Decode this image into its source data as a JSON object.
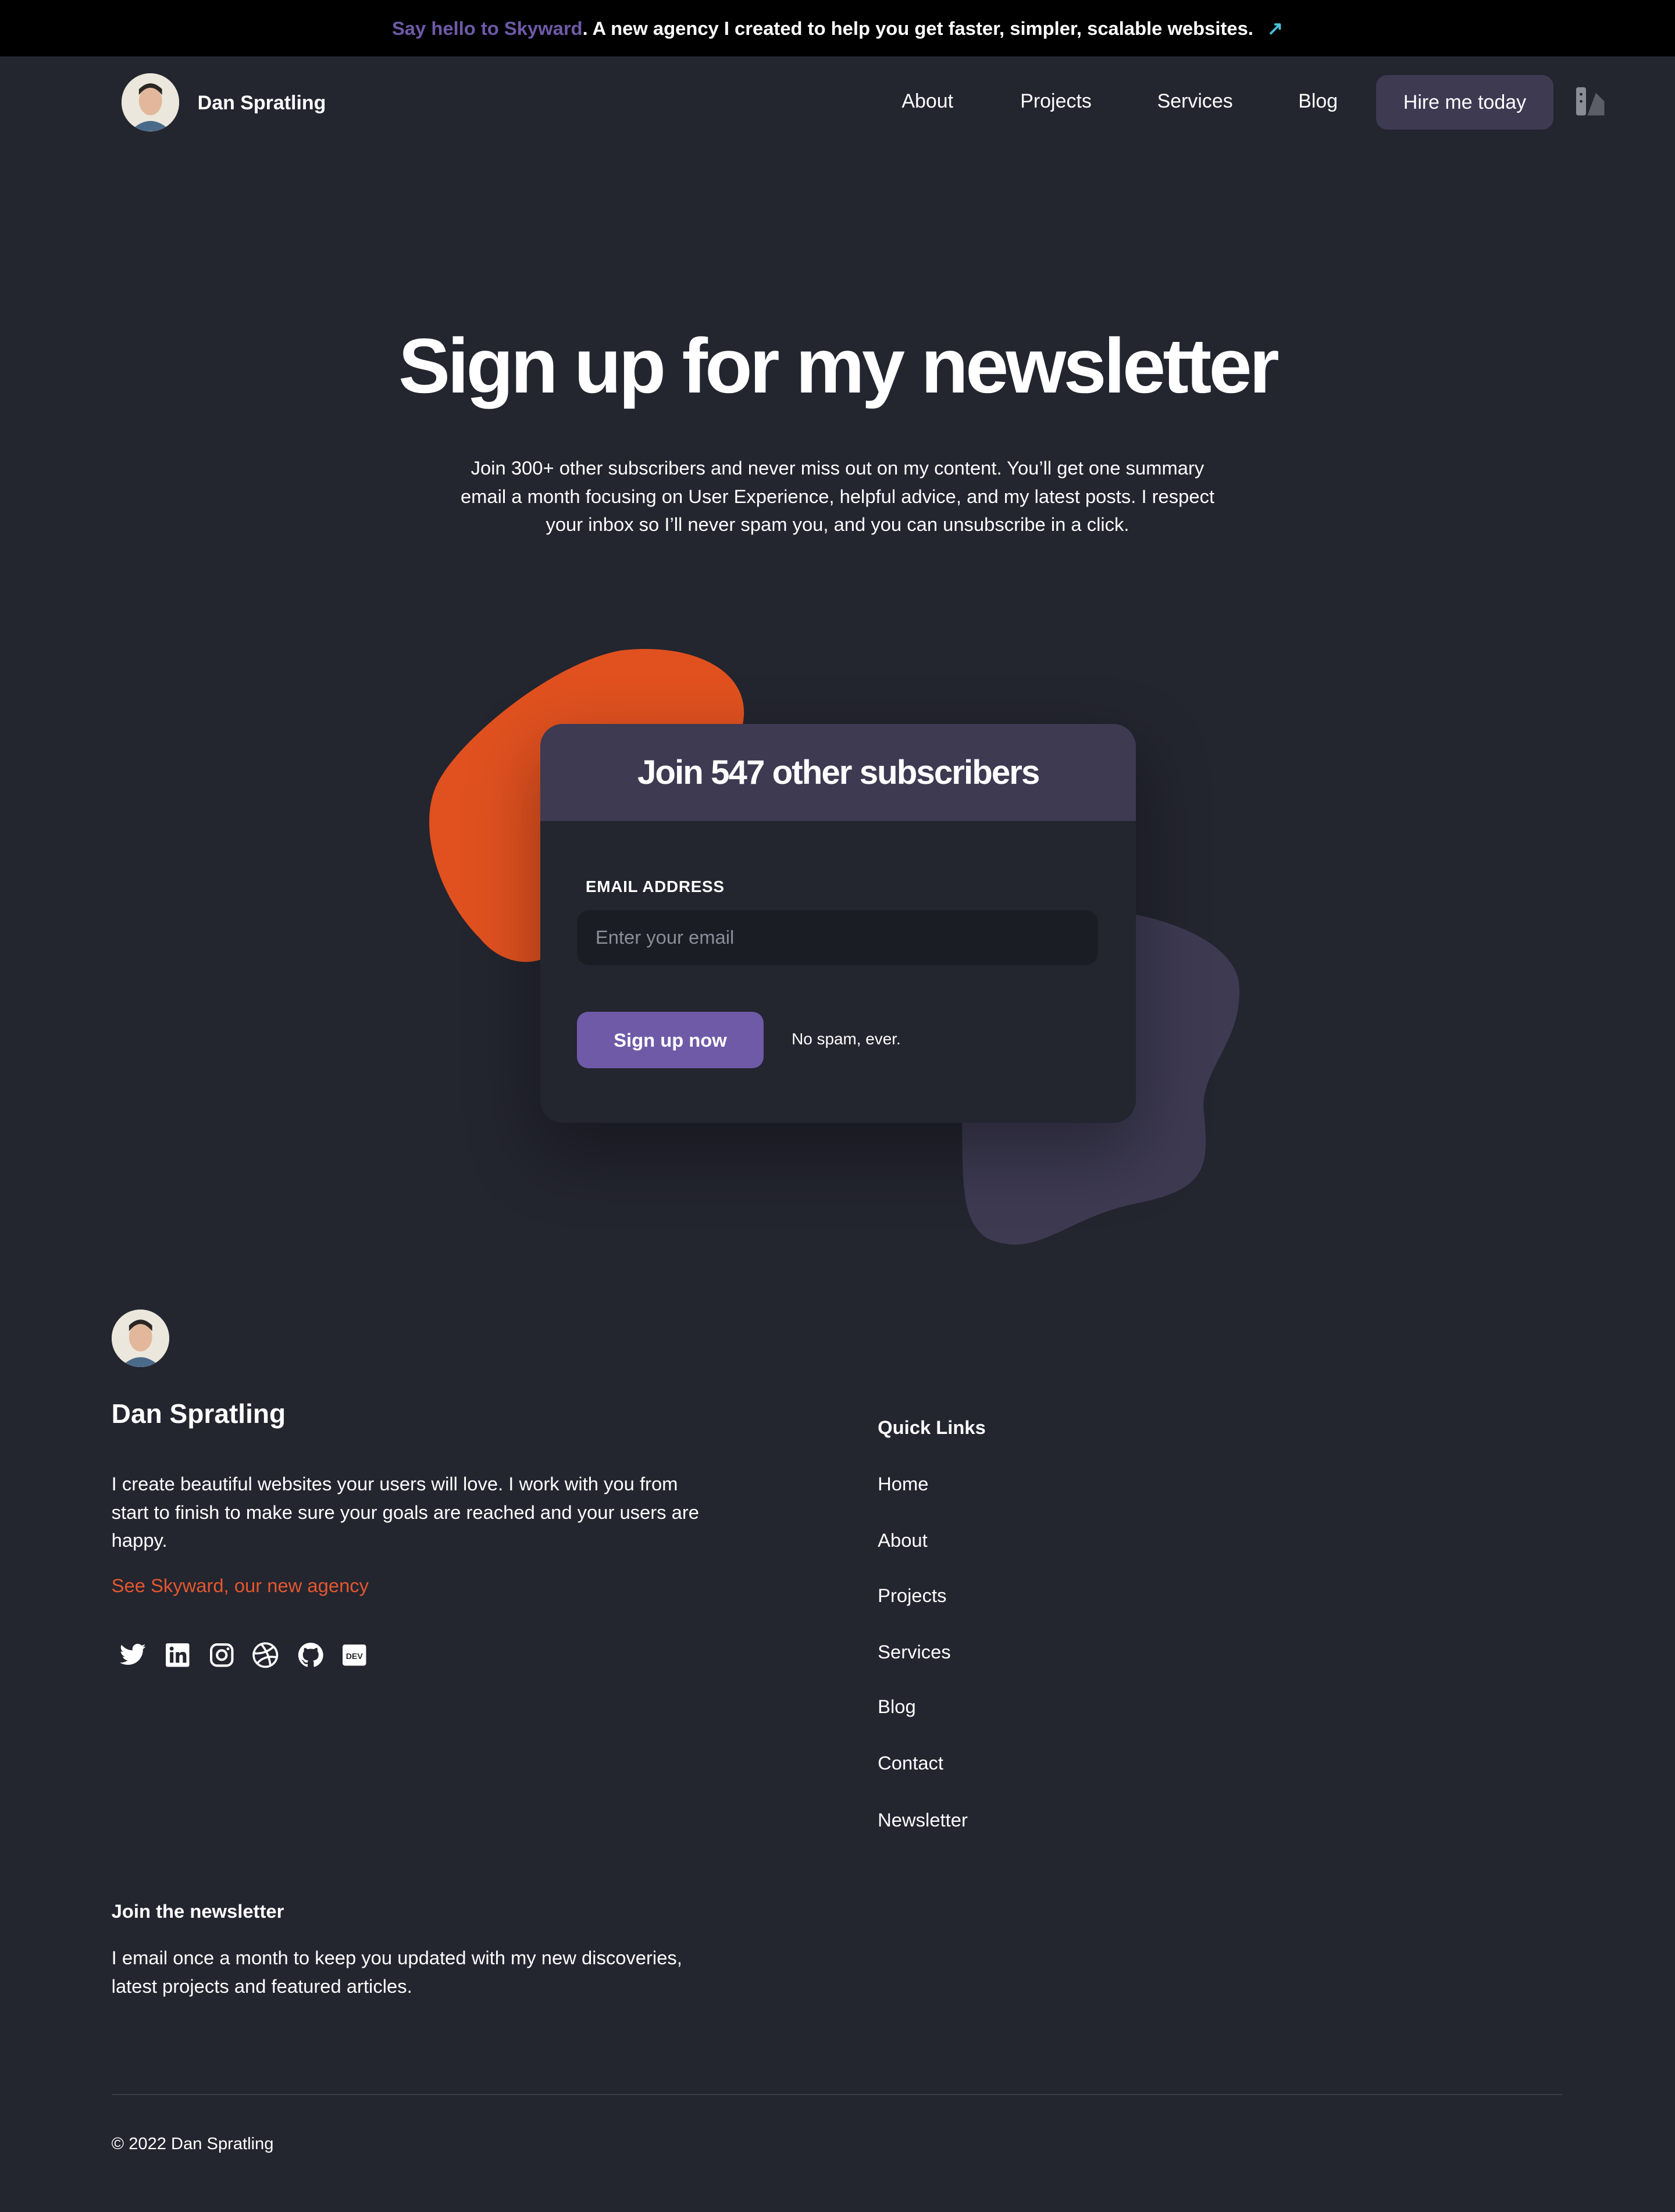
{
  "banner": {
    "highlight": "Say hello to Skyward",
    "text": ". A new agency I created to help you get faster, simpler, scalable websites.",
    "icon": "arrow-up-right-icon"
  },
  "nav": {
    "name": "Dan Spratling",
    "links": [
      "About",
      "Projects",
      "Services",
      "Blog"
    ],
    "cta": "Hire me today",
    "theme_icon": "theme-toggle-icon"
  },
  "hero": {
    "title": "Sign up for my newsletter",
    "description": "Join 300+ other subscribers and never miss out on my content. You’ll get one summary email a month focusing on User Experience, helpful advice, and my latest posts. I respect your inbox so I’ll never spam you, and you can unsubscribe in a click."
  },
  "card": {
    "title": "Join 547 other subscribers",
    "email_label": "EMAIL ADDRESS",
    "email_placeholder": "Enter your email",
    "email_value": "",
    "button": "Sign up now",
    "note": "No spam, ever."
  },
  "footer": {
    "name": "Dan Spratling",
    "bio": "I create beautiful websites your users will love. I work with you from start to finish to make sure your goals are reached and your users are happy.",
    "agency_link": "See Skyward, our new agency",
    "social": [
      "twitter-icon",
      "linkedin-icon",
      "instagram-icon",
      "dribbble-icon",
      "github-icon",
      "dev-icon"
    ],
    "quick_links_title": "Quick Links",
    "quick_links": [
      "Home",
      "About",
      "Projects",
      "Services",
      "Blog",
      "Contact",
      "Newsletter"
    ],
    "newsletter_title": "Join the newsletter",
    "newsletter_text": "I email once a month to keep you updated with my new discoveries, latest projects and featured articles.",
    "copyright": "© 2022 Dan Spratling"
  },
  "colors": {
    "background": "#23252f",
    "accent": "#6f5aa8",
    "orange": "#e0511f",
    "card_header": "#3d3a52"
  }
}
